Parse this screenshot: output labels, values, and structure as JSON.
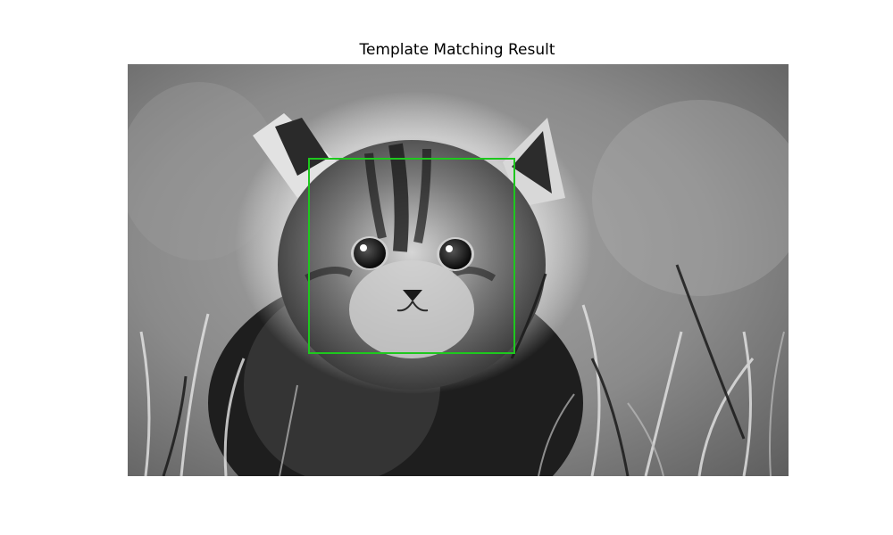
{
  "figure": {
    "title": "Template Matching Result",
    "image": {
      "subject": "grayscale photo of a fluffy kitten sitting in grass",
      "colors": {
        "box_stroke": "#1ec81e"
      }
    }
  }
}
